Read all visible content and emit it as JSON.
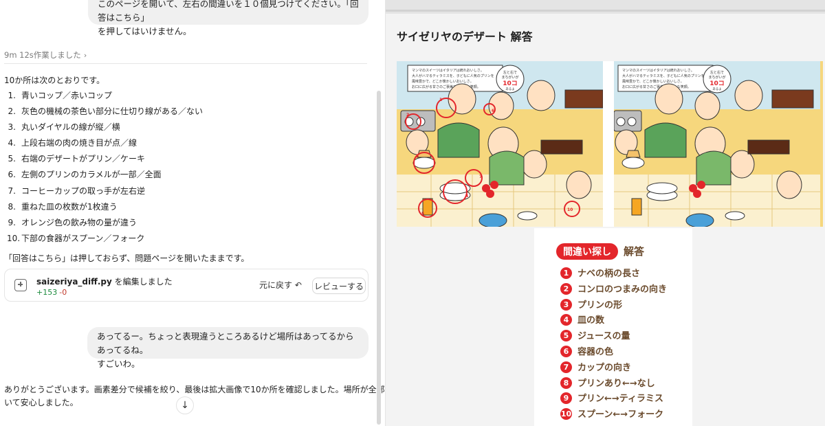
{
  "chat": {
    "user_message_top": {
      "line1": "このページを開いて、左右の間違いを１０個見つけてください。「回答はこちら」",
      "line2": "を押してはいけません。"
    },
    "worked_label": "9m 12s作業しました",
    "intro": "10か所は次のとおりです。",
    "differences": [
      {
        "num": "1.",
        "text": "青いコップ／赤いコップ"
      },
      {
        "num": "2.",
        "text": "灰色の機械の茶色い部分に仕切り線がある／ない"
      },
      {
        "num": "3.",
        "text": "丸いダイヤルの線が縦／横"
      },
      {
        "num": "4.",
        "text": "上段右端の肉の焼き目が点／線"
      },
      {
        "num": "5.",
        "text": "右端のデザートがプリン／ケーキ"
      },
      {
        "num": "6.",
        "text": "左側のプリンのカラメルが一部／全面"
      },
      {
        "num": "7.",
        "text": "コーヒーカップの取っ手が左右逆"
      },
      {
        "num": "8.",
        "text": "重ねた皿の枚数が1枚違う"
      },
      {
        "num": "9.",
        "text": "オレンジ色の飲み物の量が違う"
      },
      {
        "num": "10.",
        "text": "下部の食器がスプーン／フォーク"
      }
    ],
    "note": "「回答はこちら」は押しておらず、問題ページを開いたままです。",
    "file_card": {
      "filename": "saizeriya_diff.py",
      "action": " を編集しました",
      "additions": "+153",
      "deletions": "-0",
      "undo_label": "元に戻す ↶",
      "review_label": "レビューする"
    },
    "user_message_mid": {
      "line1": "あってるー。ちょっと表現違うところあるけど場所はあってるからあってるね。",
      "line2": "すごいわ。"
    },
    "reply": {
      "line1": "ありがとうございます。画素差分で候補を絞り、最後は拡大画像で10か所を確認しました。場所が全部合って",
      "line2": "いて安心しました。"
    },
    "scroll_down_glyph": "↓"
  },
  "web": {
    "title": "サイゼリヤのデザート 解答",
    "puzzle": {
      "caption_line1": "マンマのスイーツはイタリアは統れおいしさ。",
      "caption_line2": "大人がハマるティラミスを、子どもに人気のプリンを",
      "caption_line3": "風味豊かで、どこか懐かしいおいしさ。",
      "caption_line4": "お口に広がる甘さのご褒美で、みんな笑顔。",
      "badge_line1": "左と右で",
      "badge_line2": "まちがいが",
      "badge_count": "10コ",
      "badge_line3": "あるよ",
      "circle_labels": [
        "1",
        "2",
        "3",
        "4",
        "5",
        "6",
        "7",
        "8",
        "9",
        "10"
      ]
    },
    "answers": {
      "badge": "間違い探し",
      "title": "解答",
      "items": [
        {
          "num": "1",
          "text": "ナベの柄の長さ"
        },
        {
          "num": "2",
          "text": "コンロのつまみの向き"
        },
        {
          "num": "3",
          "text": "プリンの形"
        },
        {
          "num": "4",
          "text": "皿の数"
        },
        {
          "num": "5",
          "text": "ジュースの量"
        },
        {
          "num": "6",
          "text": "容器の色"
        },
        {
          "num": "7",
          "text": "カップの向き"
        },
        {
          "num": "8",
          "text": "プリンあり←→なし"
        },
        {
          "num": "9",
          "text": "プリン←→ティラミス"
        },
        {
          "num": "10",
          "text": "スプーン←→フォーク"
        }
      ]
    }
  },
  "colors": {
    "accent_red": "#e3262b",
    "answer_brown": "#6a4a2c",
    "diff_add": "#1a8a3c",
    "diff_del": "#c0392b",
    "puzzle_yellow": "#f6d77d"
  }
}
